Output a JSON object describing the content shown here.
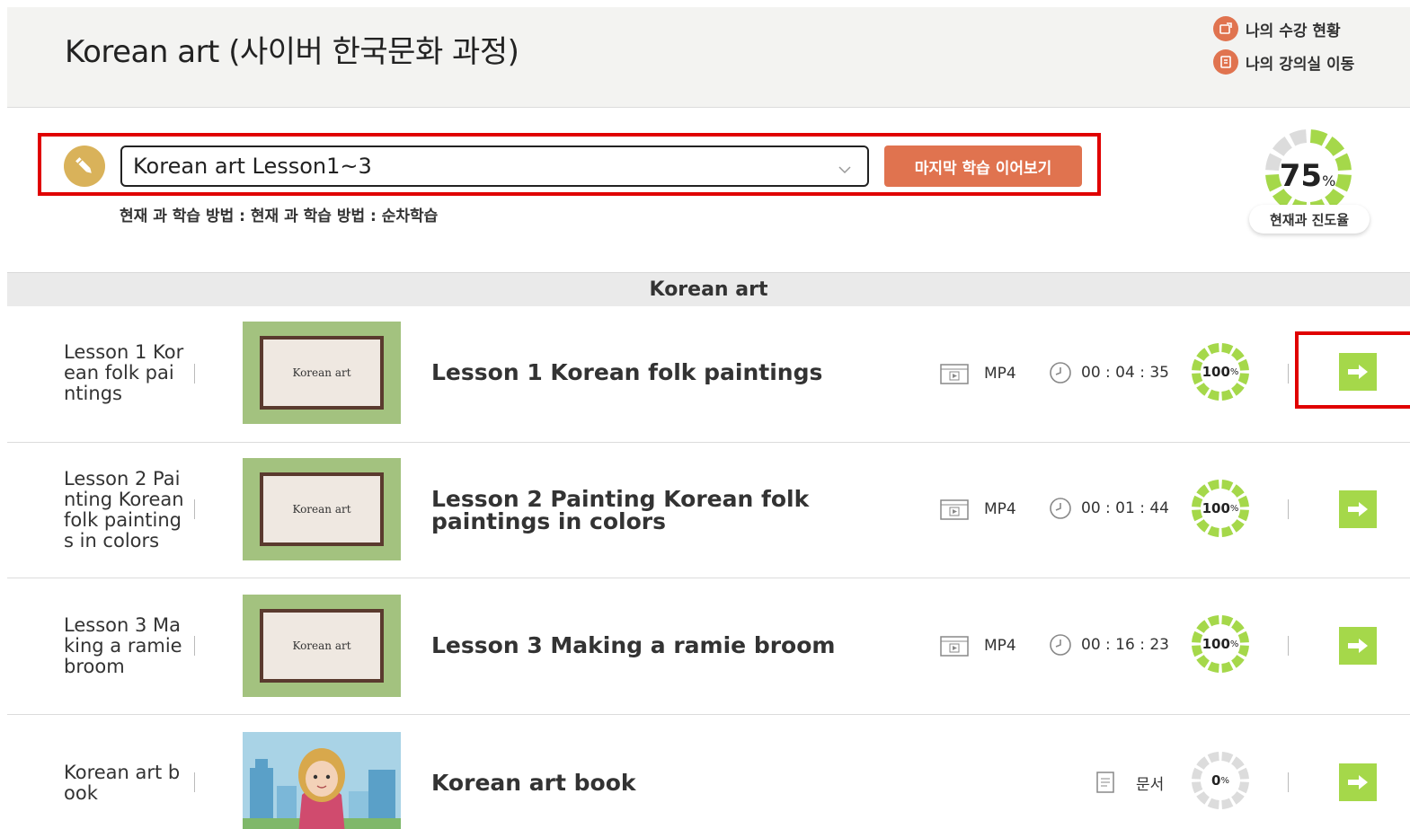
{
  "header": {
    "title": "Korean art (사이버 한국문화 과정)",
    "my_status_label": "나의 수강 현황",
    "my_classroom_label": "나의 강의실 이동"
  },
  "selector": {
    "selected": "Korean art Lesson1~3",
    "continue_label": "마지막 학습 이어보기",
    "method_text": "현재 과 학습 방법 : 현재 과 학습 방법 : 순차학습"
  },
  "overall_progress": {
    "value": "75",
    "unit": "%",
    "label": "현재과 진도율",
    "fraction": 0.75
  },
  "section": {
    "title": "Korean art"
  },
  "rows": [
    {
      "short": "Lesson 1 Korean folk paintings",
      "thumb_text": "Korean art",
      "title_lines": [
        "Lesson 1 Korean folk paintings"
      ],
      "type": "MP4",
      "duration": "00 : 04 : 35",
      "progress": "100",
      "unit": "%",
      "fraction": 1.0
    },
    {
      "short": "Lesson 2 Painting Korean folk paintings in colors",
      "thumb_text": "Korean art",
      "title_lines": [
        "Lesson 2 Painting Korean folk",
        "paintings in colors"
      ],
      "type": "MP4",
      "duration": "00 : 01 : 44",
      "progress": "100",
      "unit": "%",
      "fraction": 1.0
    },
    {
      "short": "Lesson 3 Making a ramie broom",
      "thumb_text": "Korean art",
      "title_lines": [
        "Lesson 3 Making a ramie broom"
      ],
      "type": "MP4",
      "duration": "00 : 16 : 23",
      "progress": "100",
      "unit": "%",
      "fraction": 1.0
    },
    {
      "short": "Korean art book",
      "title_lines": [
        "Korean art book"
      ],
      "type": "문서",
      "progress": "0",
      "unit": "%",
      "fraction": 0.0
    }
  ],
  "colors": {
    "accent": "#e0734f",
    "progress_green": "#a5d84a",
    "ring_gray": "#dcdcdc",
    "highlight_red": "#e00000"
  },
  "icons": {
    "video": "film-icon",
    "clock": "clock-icon",
    "doc": "document-icon",
    "go": "arrow-right-icon",
    "pencil": "pencil-icon"
  }
}
